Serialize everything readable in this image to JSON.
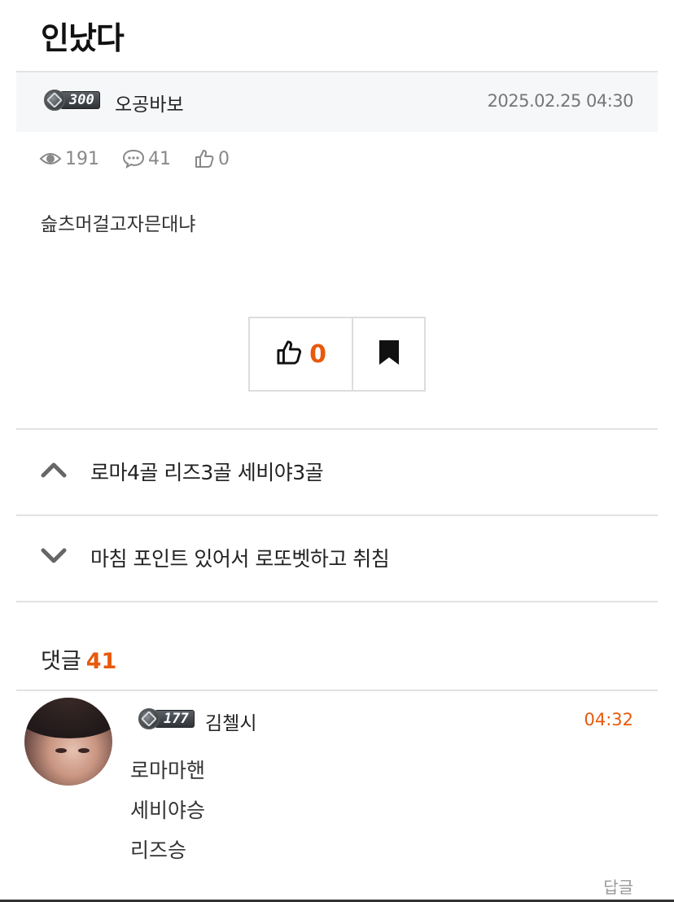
{
  "post": {
    "title": "인났다",
    "author": {
      "level": "300",
      "name": "오공바보"
    },
    "date": "2025.02.25 04:30",
    "stats": {
      "views": "191",
      "comments": "41",
      "likes": "0"
    },
    "body": "슲츠머걸고자믄대냐"
  },
  "actions": {
    "like_count": "0"
  },
  "nav": {
    "prev_title": "로마4골 리즈3골 세비야3골",
    "next_title": "마침 포인트 있어서 로또벳하고 취침"
  },
  "comments": {
    "label": "댓글",
    "count": "41",
    "items": [
      {
        "level": "177",
        "author": "김첼시",
        "time": "04:32",
        "lines": [
          "로마마핸",
          "세비야승",
          "리즈승"
        ],
        "reply_label": "답글"
      }
    ]
  },
  "colors": {
    "accent": "#e8590c",
    "muted": "#888888",
    "divider": "#e2e2e2",
    "author_bar_bg": "#f6f7f9"
  },
  "icons": [
    "eye-icon",
    "comment-icon",
    "thumbs-up-icon",
    "bookmark-icon",
    "chevron-up-icon",
    "chevron-down-icon",
    "level-emblem-icon"
  ]
}
